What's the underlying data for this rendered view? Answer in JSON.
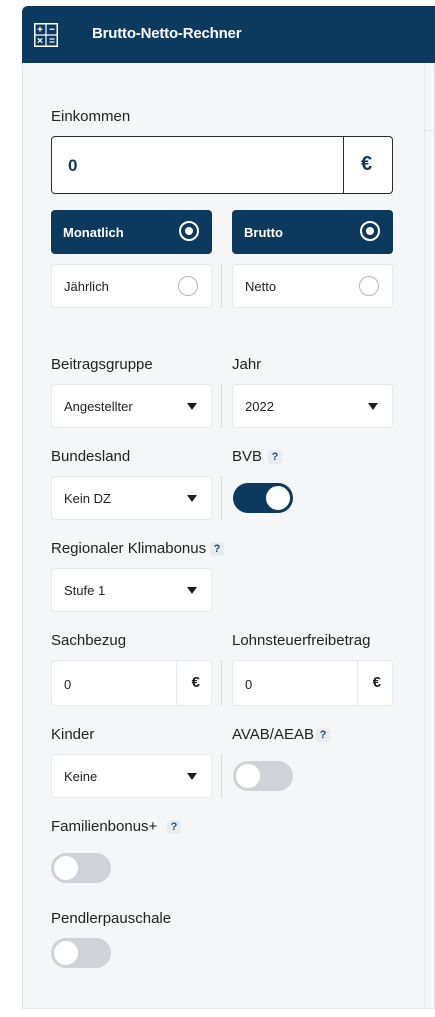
{
  "header": {
    "title": "Brutto-Netto-Rechner",
    "icon": "calculator-icon"
  },
  "income": {
    "label": "Einkommen",
    "value": "0",
    "currency": "€"
  },
  "period": {
    "options": [
      {
        "label": "Monatlich",
        "selected": true
      },
      {
        "label": "Jährlich",
        "selected": false
      }
    ]
  },
  "type": {
    "options": [
      {
        "label": "Brutto",
        "selected": true
      },
      {
        "label": "Netto",
        "selected": false
      }
    ]
  },
  "beitragsgruppe": {
    "label": "Beitragsgruppe",
    "value": "Angestellter"
  },
  "jahr": {
    "label": "Jahr",
    "value": "2022"
  },
  "bundesland": {
    "label": "Bundesland",
    "value": "Kein DZ"
  },
  "bvb": {
    "label": "BVB",
    "help": "?",
    "enabled": true
  },
  "klimabonus": {
    "label": "Regionaler Klimabonus",
    "help": "?",
    "value": "Stufe 1"
  },
  "sachbezug": {
    "label": "Sachbezug",
    "value": "0",
    "currency": "€"
  },
  "lohnsteuer": {
    "label": "Lohnsteuerfreibetrag",
    "value": "0",
    "currency": "€"
  },
  "kinder": {
    "label": "Kinder",
    "value": "Keine"
  },
  "avab": {
    "label": "AVAB/AEAB",
    "help": "?",
    "enabled": false
  },
  "familienbonus": {
    "label": "Familienbonus+",
    "help": "?",
    "enabled": false
  },
  "pendler": {
    "label": "Pendlerpauschale",
    "enabled": false
  },
  "colors": {
    "primary": "#0c3a5e",
    "background": "#f5f6f8",
    "toggle_off": "#cfd2d6"
  }
}
